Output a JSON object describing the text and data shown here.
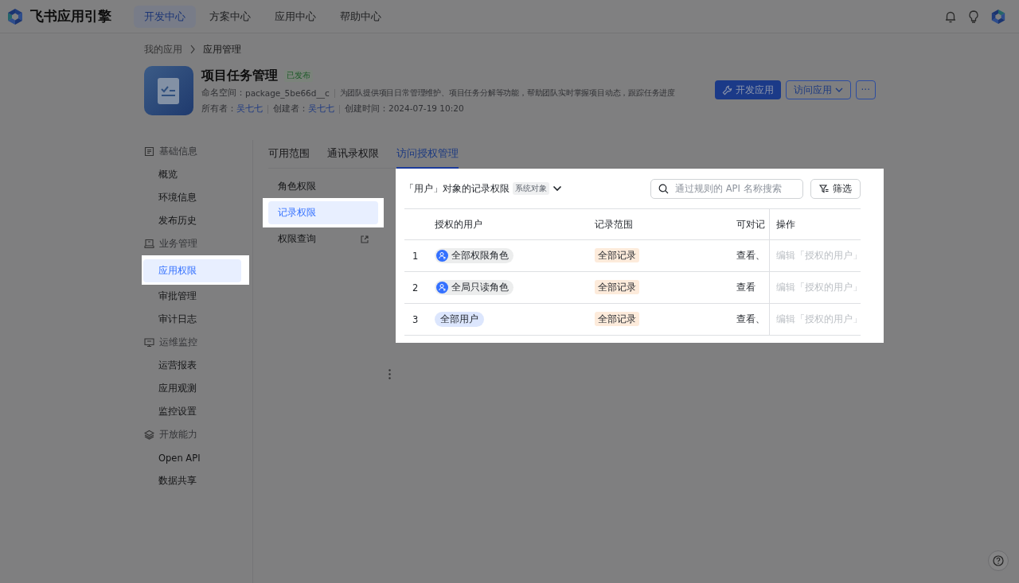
{
  "header": {
    "logo": "飞书应用引擎",
    "nav": [
      {
        "label": "开发中心",
        "selected": true
      },
      {
        "label": "方案中心",
        "selected": false
      },
      {
        "label": "应用中心",
        "selected": false
      },
      {
        "label": "帮助中心",
        "selected": false
      }
    ]
  },
  "breadcrumb": [
    "我的应用",
    "应用管理"
  ],
  "app": {
    "name": "项目任务管理",
    "status": "已发布",
    "namespace_label": "命名空间：",
    "namespace": "package_5be66d__c",
    "description": "为团队提供项目日常管理维护、项目任务分解等功能，帮助团队实时掌握项目动态，跟踪任务进度",
    "owner_label": "所有者：",
    "owner": "吴七七",
    "creator_label": "创建者：",
    "creator": "吴七七",
    "created_label": "创建时间：",
    "created": "2024-07-19 10:20"
  },
  "actions": {
    "primary": "开发应用",
    "secondary": "访问应用",
    "more": "···"
  },
  "sidebar": [
    {
      "label": "基础信息",
      "items": [
        {
          "label": "概览",
          "selected": false
        },
        {
          "label": "环境信息",
          "selected": false
        },
        {
          "label": "发布历史",
          "selected": false
        }
      ]
    },
    {
      "label": "业务管理",
      "items": [
        {
          "label": "应用权限",
          "selected": true
        },
        {
          "label": "审批管理",
          "selected": false
        },
        {
          "label": "审计日志",
          "selected": false
        }
      ]
    },
    {
      "label": "运维监控",
      "items": [
        {
          "label": "运营报表",
          "selected": false
        },
        {
          "label": "应用观测",
          "selected": false
        },
        {
          "label": "监控设置",
          "selected": false
        }
      ]
    },
    {
      "label": "开放能力",
      "items": [
        {
          "label": "Open API",
          "selected": false
        },
        {
          "label": "数据共享",
          "selected": false
        }
      ]
    }
  ],
  "tabs": [
    {
      "label": "可用范围",
      "selected": false
    },
    {
      "label": "通讯录权限",
      "selected": false
    },
    {
      "label": "访问授权管理",
      "selected": true
    }
  ],
  "subnav": [
    {
      "label": "角色权限",
      "selected": false,
      "external": false
    },
    {
      "label": "记录权限",
      "selected": true,
      "external": false
    },
    {
      "label": "权限查询",
      "selected": false,
      "external": true
    }
  ],
  "panel": {
    "spotlight": true,
    "object_label": "「用户」对象的记录权限",
    "object_tag": "系统对象",
    "search_placeholder": "通过规则的 API 名称搜索",
    "filter": "筛选",
    "columns": [
      "授权的用户",
      "记录范围",
      "可对记",
      "操作"
    ],
    "rows": [
      {
        "index": "1",
        "user": "全部权限角色",
        "kind": "role",
        "scope": "全部记录",
        "access": "查看、",
        "action": "编辑「授权的用户」"
      },
      {
        "index": "2",
        "user": "全局只读角色",
        "kind": "role",
        "scope": "全部记录",
        "access": "查看",
        "action": "编辑「授权的用户」"
      },
      {
        "index": "3",
        "user": "全部用户",
        "kind": "all",
        "scope": "全部记录",
        "access": "查看、",
        "action": "编辑「授权的用户」"
      }
    ]
  }
}
